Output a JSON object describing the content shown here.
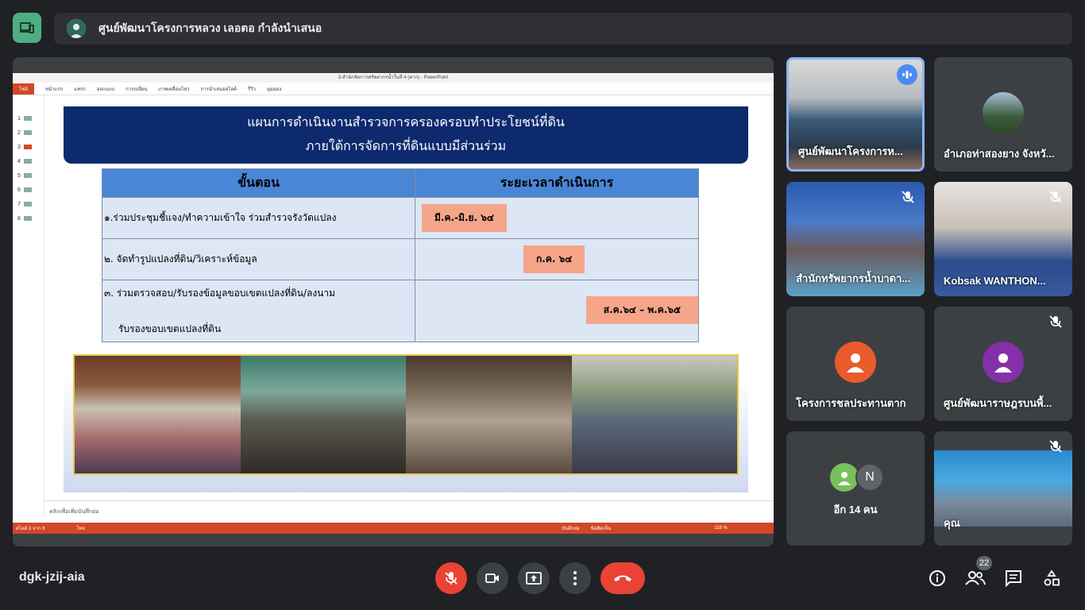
{
  "header": {
    "presenting_text": "ศูนย์พัฒนาโครงการหลวง เลอตอ กำลังนำเสนอ"
  },
  "presentation": {
    "window_title": "3.สำนักจัดการทรัพยากรน้ำในที่ 4 (ตาก) - PowerPoint",
    "ribbon_tabs": [
      "ไฟล์",
      "หน้าแรก",
      "แทรก",
      "ออกแบบ",
      "การเปลี่ยน",
      "ภาพเคลื่อนไหว",
      "การนำเสนอสไลด์",
      "รีวิว",
      "มุมมอง"
    ],
    "slide_numbers": [
      "1",
      "2",
      "3",
      "4",
      "5",
      "6",
      "7",
      "8"
    ],
    "notes_placeholder": "คลิกเพื่อเพิ่มบันทึกย่อ",
    "status_left": "สไลด์ 3 จาก 8",
    "status_lang": "ไทย",
    "status_notes": "บันทึกย่อ",
    "status_comments": "ข้อคิดเห็น",
    "zoom": "118 %"
  },
  "slide": {
    "title_line1": "แผนการดำเนินงานสำรวจการครองครอบทำประโยชน์ที่ดิน",
    "title_line2": "ภายใต้การจัดการที่ดินแบบมีส่วนร่วม",
    "col_step": "ขั้นตอน",
    "col_time": "ระยะเวลาดำเนินการ",
    "rows": [
      {
        "step": "๑.ร่วมประชุมชี้แจง/ทำความเข้าใจ  ร่วมสำรวจรังวัดแปลง",
        "time": "มี.ค.-มิ.ย. ๖๔"
      },
      {
        "step": "๒. จัดทำรูปแปลงที่ดิน/วิเคราะห์ข้อมูล",
        "time": "ก.ค. ๖๔"
      },
      {
        "step": "๓. ร่วมตรวจสอบ/รับรองข้อมูลขอบเขตแปลงที่ดิน/ลงนาม",
        "step2": "รับรองขอบเขตแปลงที่ดิน",
        "time": "ส.ค.๖๔ – พ.ค.๖๕"
      }
    ]
  },
  "participants": [
    {
      "name": "ศูนย์พัฒนาโครงการห...",
      "kind": "video",
      "speaking": true
    },
    {
      "name": "อำเภอท่าสองยาง จังหวั...",
      "kind": "avatar-photo"
    },
    {
      "name": "สำนักทรัพยากรน้ำบาดา...",
      "kind": "video",
      "muted": true
    },
    {
      "name": "Kobsak WANTHON...",
      "kind": "video",
      "muted": true
    },
    {
      "name": "โครงการชลประทานตาก",
      "kind": "avatar",
      "color": "#ea5a2d"
    },
    {
      "name": "ศูนย์พัฒนาราษฎรบนพื้...",
      "kind": "avatar",
      "color": "#8430a8",
      "muted": true
    },
    {
      "name": "อีก 14 คน",
      "kind": "more",
      "initial": "N"
    },
    {
      "name": "คุณ",
      "kind": "video",
      "muted": true
    }
  ],
  "footer": {
    "meeting_code": "dgk-jzij-aia",
    "participant_count": "22"
  },
  "colors": {
    "end_call": "#ea4335",
    "accent_green": "#4caf82",
    "slide_header": "#0e2a6e"
  },
  "icons": [
    "laptop-icon",
    "mic-off-icon",
    "camera-icon",
    "present-icon",
    "more-vert-icon",
    "end-call-icon",
    "info-icon",
    "people-icon",
    "chat-icon",
    "activities-icon"
  ]
}
